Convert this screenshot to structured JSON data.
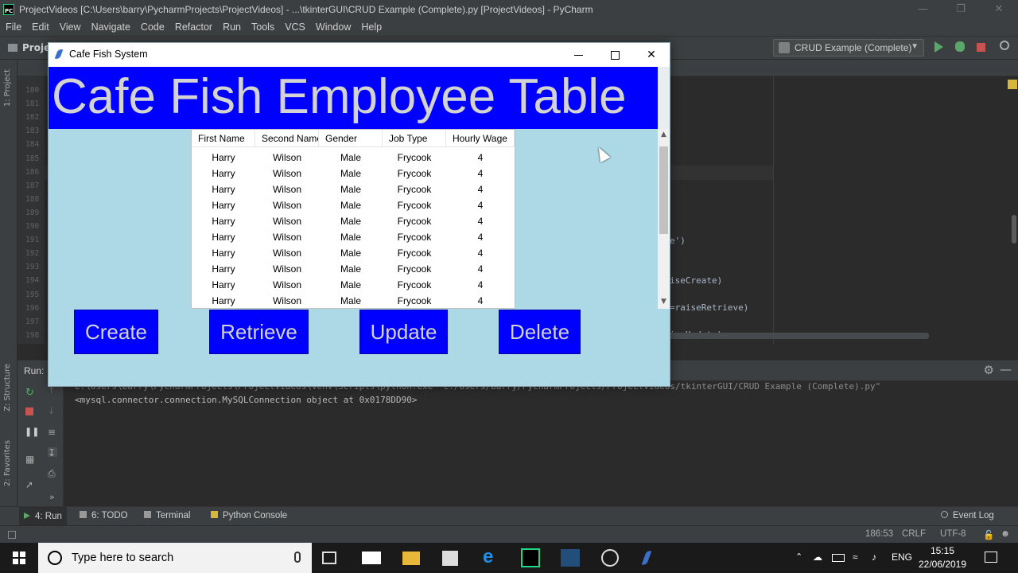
{
  "ide": {
    "title": "ProjectVideos [C:\\Users\\barry\\PycharmProjects\\ProjectVideos] - ...\\tkinterGUI\\CRUD Example (Complete).py [ProjectVideos] - PyCharm",
    "menu": [
      "File",
      "Edit",
      "View",
      "Navigate",
      "Code",
      "Refactor",
      "Run",
      "Tools",
      "VCS",
      "Window",
      "Help"
    ],
    "nav_project": "Projec",
    "run_config": "CRUD Example (Complete)",
    "line_numbers": [
      "180",
      "181",
      "182",
      "183",
      "184",
      "185",
      "186",
      "187",
      "188",
      "189",
      "190",
      "191",
      "192",
      "193",
      "194",
      "195",
      "196",
      "197",
      "198"
    ],
    "code_fragments": [
      "e')",
      "iseCreate)",
      "=raiseRetrieve)",
      "iseUpdate)"
    ],
    "left_strip": [
      "1: Project",
      "Z: Structure",
      "2: Favorites"
    ],
    "run_panel": {
      "label": "Run:",
      "console_lines": [
        "C:\\Users\\barry\\PycharmProjects\\ProjectVideos\\venv\\Scripts\\python.exe \"C:/Users/barry/PycharmProjects/ProjectVideos/tkinterGUI/CRUD Example (Complete).py\"",
        "<mysql.connector.connection.MySQLConnection object at 0x0178DD90>"
      ]
    },
    "tool_windows": {
      "run": "4: Run",
      "todo": "6: TODO",
      "terminal": "Terminal",
      "python_console": "Python Console",
      "event_log": "Event Log"
    },
    "status": {
      "position": "186:53",
      "line_sep": "CRLF",
      "encoding": "UTF-8"
    }
  },
  "app": {
    "window_title": "Cafe Fish System",
    "heading": "Cafe Fish Employee Table",
    "columns": [
      "First Name",
      "Second Name",
      "Gender",
      "Job Type",
      "Hourly Wage"
    ],
    "rows": [
      [
        "Harry",
        "Wilson",
        "Male",
        "Frycook",
        "4"
      ],
      [
        "Harry",
        "Wilson",
        "Male",
        "Frycook",
        "4"
      ],
      [
        "Harry",
        "Wilson",
        "Male",
        "Frycook",
        "4"
      ],
      [
        "Harry",
        "Wilson",
        "Male",
        "Frycook",
        "4"
      ],
      [
        "Harry",
        "Wilson",
        "Male",
        "Frycook",
        "4"
      ],
      [
        "Harry",
        "Wilson",
        "Male",
        "Frycook",
        "4"
      ],
      [
        "Harry",
        "Wilson",
        "Male",
        "Frycook",
        "4"
      ],
      [
        "Harry",
        "Wilson",
        "Male",
        "Frycook",
        "4"
      ],
      [
        "Harry",
        "Wilson",
        "Male",
        "Frycook",
        "4"
      ],
      [
        "Harry",
        "Wilson",
        "Male",
        "Frycook",
        "4"
      ]
    ],
    "buttons": {
      "create": "Create",
      "retrieve": "Retrieve",
      "update": "Update",
      "delete": "Delete"
    },
    "colors": {
      "background": "#add8e6",
      "banner": "#0000ff",
      "button": "#0000ff",
      "button_text": "#d3d3d3"
    }
  },
  "taskbar": {
    "search_placeholder": "Type here to search",
    "language": "ENG",
    "time": "15:15",
    "date": "22/06/2019"
  }
}
